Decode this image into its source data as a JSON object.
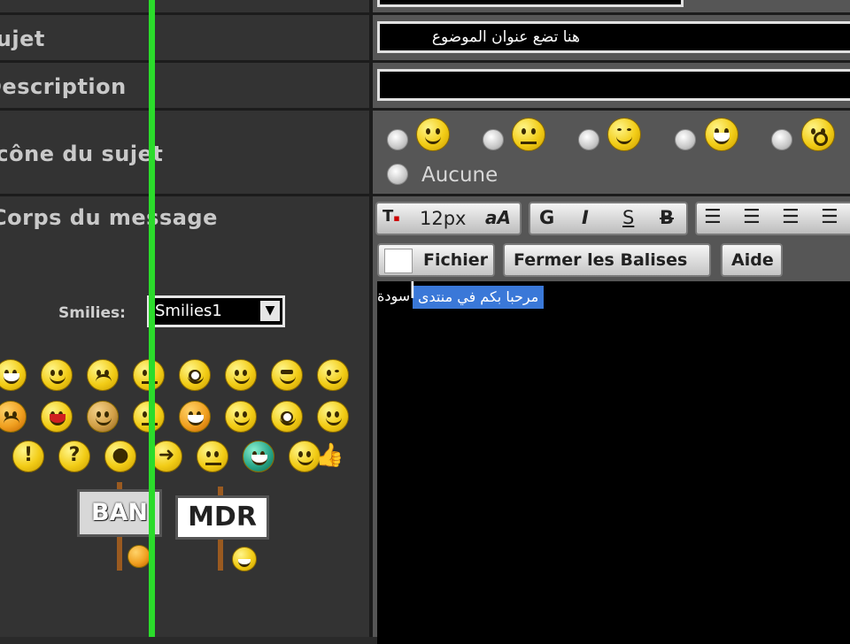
{
  "form": {
    "labels": {
      "subject": "Sujet",
      "description": "Description",
      "topic_icon": "Icône du sujet",
      "message_body": "Corps du message"
    },
    "subject_value": "هنا تضع عنوان الموضوع",
    "description_value": "",
    "icon_none_label": "Aucune"
  },
  "toolbar": {
    "font_size": "12px",
    "font_glyph": "aA",
    "bold": "G",
    "italic": "I",
    "underline": "S",
    "strike": "B",
    "file_label": "Fichier",
    "close_tags_label": "Fermer les Balises",
    "help_label": "Aide"
  },
  "editor": {
    "text_plain": "سودة",
    "text_selected": "مرحبا بكم في منتدى"
  },
  "smilies": {
    "label": "Smilies:",
    "selected": "Smilies1",
    "ban_sign": "BAN",
    "mdr_sign": "MDR"
  },
  "colors": {
    "accent_green": "#2bdc2b",
    "selection_blue": "#3a78d8",
    "smiley_yellow": "#f2cc16"
  }
}
